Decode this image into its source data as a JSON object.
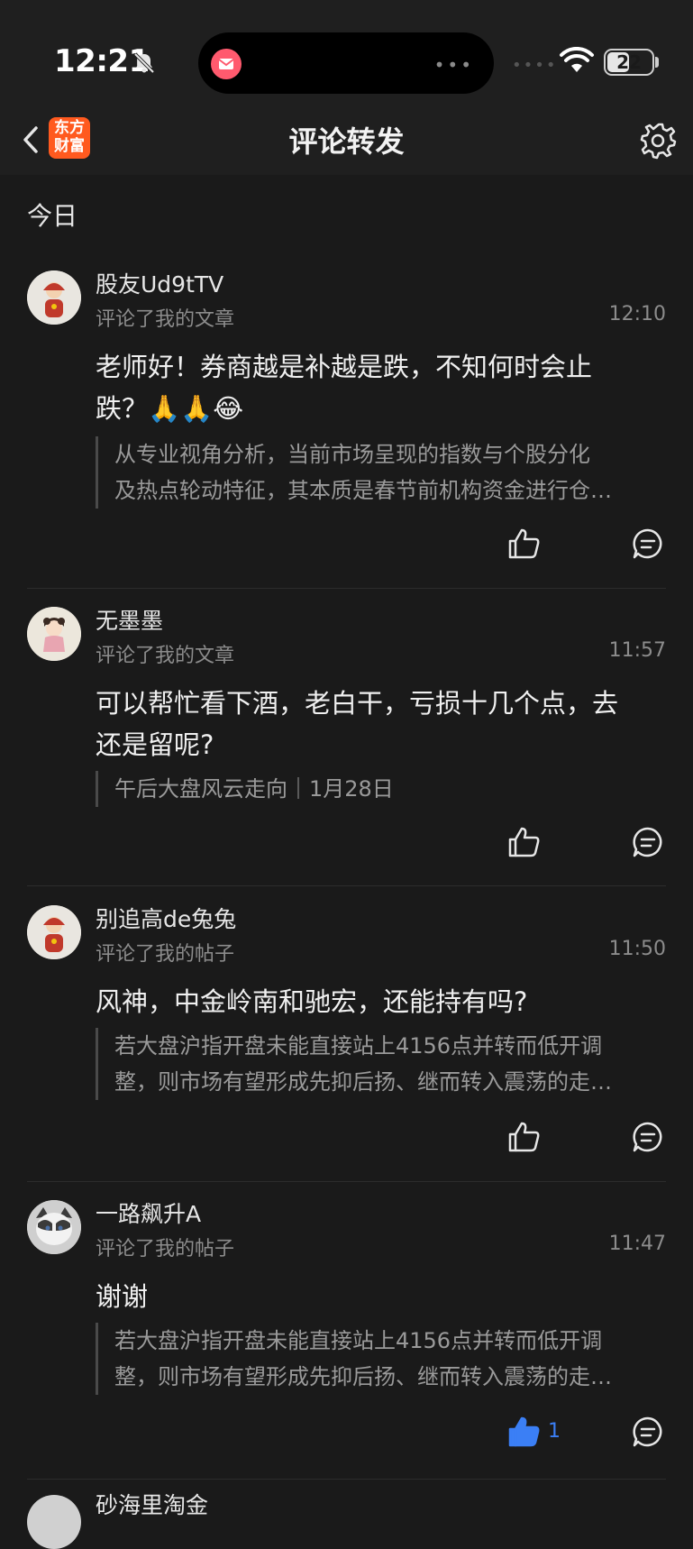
{
  "status": {
    "time": "12:21",
    "battery": "22"
  },
  "nav": {
    "logo_line1": "东方",
    "logo_line2": "财富",
    "title": "评论转发"
  },
  "section": {
    "label": "今日"
  },
  "items": [
    {
      "user": "股友Ud9tTV",
      "action": "评论了我的文章",
      "time": "12:10",
      "content": "老师好！券商越是补越是跌，不知何时会止跌？🙏🙏😂",
      "quote_lines": [
        "从专业视角分析，当前市场呈现的指数与个股分化",
        "及热点轮动特征，其本质是春节前机构资金进行仓…"
      ],
      "like_count": ""
    },
    {
      "user": "无墨墨",
      "action": "评论了我的文章",
      "time": "11:57",
      "content": "可以帮忙看下酒，老白干，亏损十几个点，去还是留呢?",
      "quote_lines": [
        "午后大盘风云走向｜1月28日"
      ],
      "like_count": ""
    },
    {
      "user": "别追高de兔兔",
      "action": "评论了我的帖子",
      "time": "11:50",
      "content": "风神，中金岭南和驰宏，还能持有吗?",
      "quote_lines": [
        "若大盘沪指开盘未能直接站上4156点并转而低开调",
        "整，则市场有望形成先抑后扬、继而转入震荡的走…"
      ],
      "like_count": ""
    },
    {
      "user": "一路飙升A",
      "action": "评论了我的帖子",
      "time": "11:47",
      "content": "谢谢",
      "quote_lines": [
        "若大盘沪指开盘未能直接站上4156点并转而低开调",
        "整，则市场有望形成先抑后扬、继而转入震荡的走…"
      ],
      "like_count": "1",
      "liked": true
    },
    {
      "user": "砂海里淘金",
      "action": "",
      "time": "",
      "content": "",
      "quote_lines": [],
      "like_count": ""
    }
  ],
  "colors": {
    "accent_blue": "#3b7ff5",
    "logo_orange": "#ff5a1f",
    "background": "#1a1a1a"
  },
  "icons": [
    "back-icon",
    "settings-gear-icon",
    "like-thumb-icon",
    "reply-bubble-icon",
    "bell-slash-icon",
    "wifi-icon",
    "battery-icon"
  ]
}
